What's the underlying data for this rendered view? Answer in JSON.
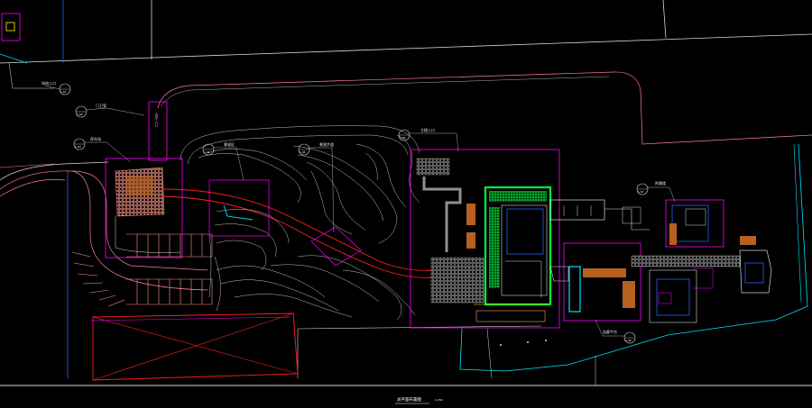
{
  "drawing": {
    "title": "总平面布置图",
    "scale": "1:250",
    "colors": {
      "background": "#000000",
      "line_white": "#d8d8d8",
      "line_magenta": "#ff00ff",
      "line_cyan": "#00e0ff",
      "line_red": "#ff2020",
      "line_green": "#00ff40",
      "line_blue": "#3060ff",
      "line_yellow": "#ffff00",
      "fill_orange": "#b86020",
      "hatch_gray": "#a0a0a0",
      "hatch_salmon": "#ff9a8a"
    },
    "callouts": [
      {
        "id": "c1",
        "label": "场地入口",
        "ref": "L-01"
      },
      {
        "id": "c2",
        "label": "门卫室",
        "ref": "L-02"
      },
      {
        "id": "c3",
        "label": "停车场",
        "ref": "L-03"
      },
      {
        "id": "c4",
        "label": "景观区",
        "ref": "L-04"
      },
      {
        "id": "c5",
        "label": "景观步道",
        "ref": "L-05"
      },
      {
        "id": "c6",
        "label": "主楼入口",
        "ref": "L-06"
      },
      {
        "id": "c7",
        "label": "附属楼",
        "ref": "L-07"
      },
      {
        "id": "c8",
        "label": "连廊平台",
        "ref": "L-08"
      }
    ],
    "vertical_sign": "会所入口"
  }
}
